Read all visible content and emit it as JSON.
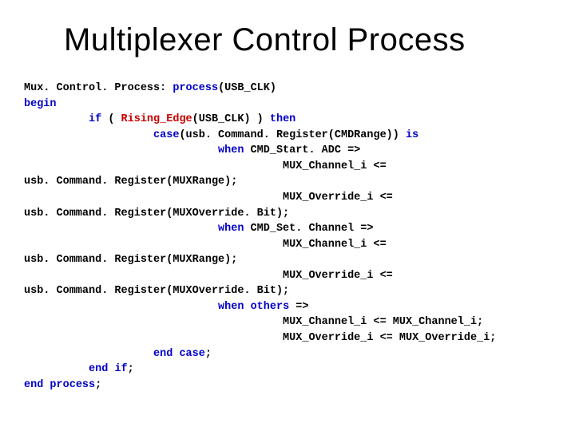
{
  "title": "Multiplexer Control Process",
  "code": {
    "l01a": "Mux. Control. Process: ",
    "l01b": "process",
    "l01c": "(USB_CLK)",
    "l02": "begin",
    "l03a": "          ",
    "l03b": "if",
    "l03c": " ( ",
    "l03d": "Rising_Edge",
    "l03e": "(USB_CLK) ) ",
    "l03f": "then",
    "l04a": "                    ",
    "l04b": "case",
    "l04c": "(usb. Command. Register(CMDRange)) ",
    "l04d": "is",
    "l05a": "                              ",
    "l05b": "when",
    "l05c": " CMD_Start. ADC =>",
    "l06": "                                        MUX_Channel_i <=",
    "l07": "usb. Command. Register(MUXRange);",
    "l08": "                                        MUX_Override_i <=",
    "l09": "usb. Command. Register(MUXOverride. Bit);",
    "l10a": "                              ",
    "l10b": "when",
    "l10c": " CMD_Set. Channel =>",
    "l11": "                                        MUX_Channel_i <=",
    "l12": "usb. Command. Register(MUXRange);",
    "l13": "                                        MUX_Override_i <=",
    "l14": "usb. Command. Register(MUXOverride. Bit);",
    "l15a": "                              ",
    "l15b": "when",
    "l15c": " ",
    "l15d": "others",
    "l15e": " =>",
    "l16": "                                        MUX_Channel_i <= MUX_Channel_i;",
    "l17": "                                        MUX_Override_i <= MUX_Override_i;",
    "l18a": "                    ",
    "l18b": "end",
    "l18c": " ",
    "l18d": "case",
    "l18e": ";",
    "l19a": "          ",
    "l19b": "end",
    "l19c": " ",
    "l19d": "if",
    "l19e": ";",
    "l20a": "",
    "l20b": "end",
    "l20c": " ",
    "l20d": "process",
    "l20e": ";"
  }
}
